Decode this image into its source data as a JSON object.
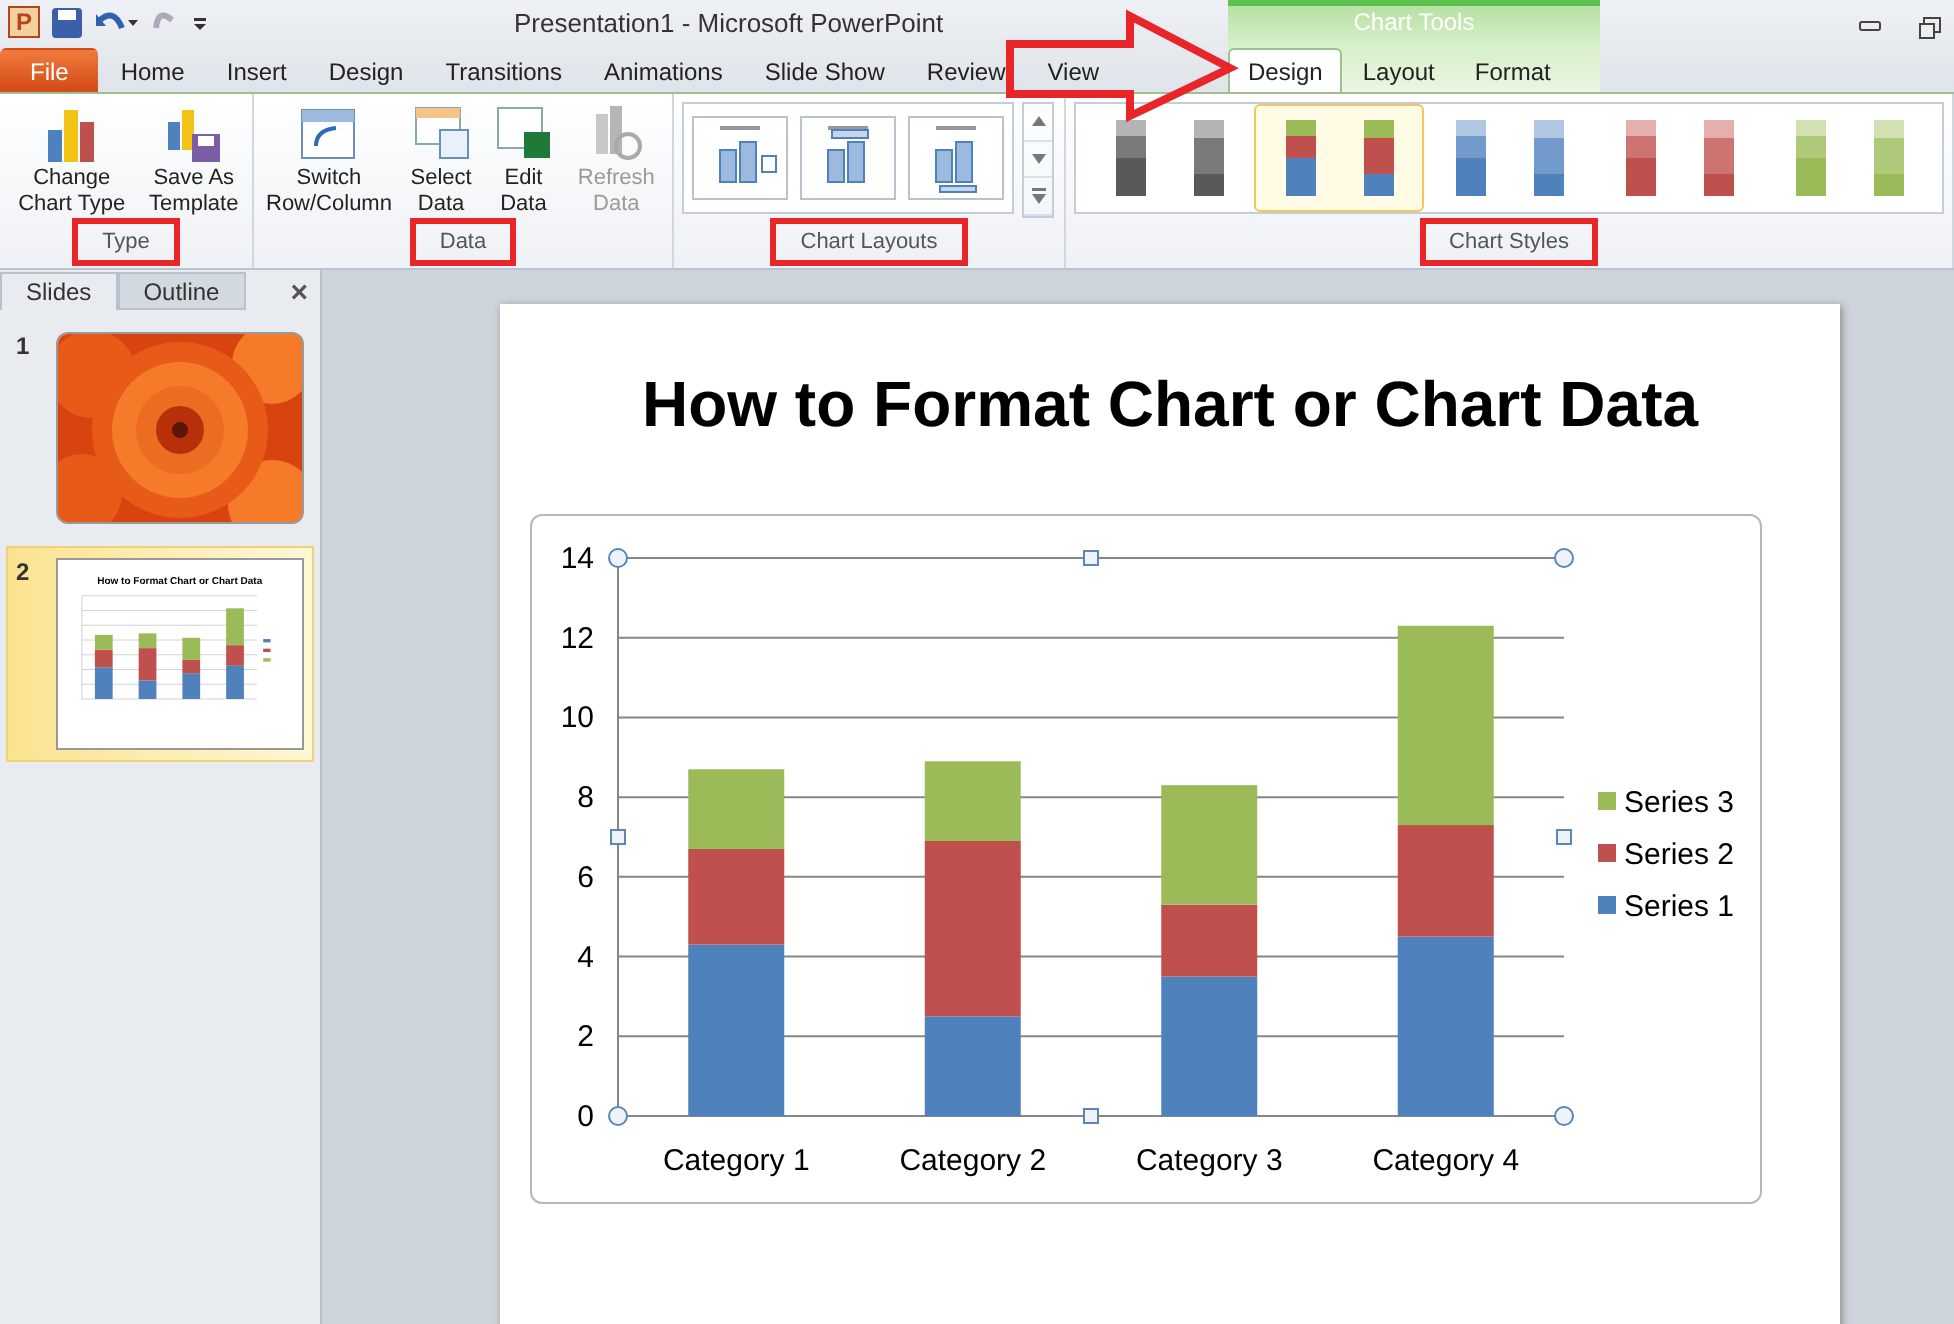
{
  "window": {
    "app_icon_letter": "P",
    "title": "Presentation1  -  Microsoft PowerPoint"
  },
  "tabs": [
    {
      "label": "File",
      "kind": "file",
      "selected": false
    },
    {
      "label": "Home",
      "kind": "tab",
      "selected": false
    },
    {
      "label": "Insert",
      "kind": "tab",
      "selected": false
    },
    {
      "label": "Design",
      "kind": "tab",
      "selected": false
    },
    {
      "label": "Transitions",
      "kind": "tab",
      "selected": false
    },
    {
      "label": "Animations",
      "kind": "tab",
      "selected": false
    },
    {
      "label": "Slide Show",
      "kind": "tab",
      "selected": false
    },
    {
      "label": "Review",
      "kind": "tab",
      "selected": false
    },
    {
      "label": "View",
      "kind": "tab",
      "selected": false
    }
  ],
  "context_tabs": {
    "title": "Chart Tools",
    "tabs": [
      {
        "label": "Design",
        "selected": true
      },
      {
        "label": "Layout",
        "selected": false
      },
      {
        "label": "Format",
        "selected": false
      }
    ]
  },
  "ribbon": {
    "groups": [
      {
        "label": "Type",
        "highlighted": true,
        "buttons": [
          {
            "label": "Change Chart Type",
            "kind": "change-type",
            "disabled": false
          },
          {
            "label": "Save As Template",
            "kind": "template",
            "disabled": false
          }
        ]
      },
      {
        "label": "Data",
        "highlighted": true,
        "buttons": [
          {
            "label": "Switch Row/Column",
            "kind": "switch",
            "disabled": false
          },
          {
            "label": "Select Data",
            "kind": "select",
            "disabled": false
          },
          {
            "label": "Edit Data",
            "kind": "edit",
            "disabled": false
          },
          {
            "label": "Refresh Data",
            "kind": "refresh",
            "disabled": true
          }
        ]
      },
      {
        "label": "Chart Layouts",
        "highlighted": true,
        "layouts": [
          {
            "kind": "legend-right"
          },
          {
            "kind": "table-top"
          },
          {
            "kind": "legend-bottom"
          }
        ]
      },
      {
        "label": "Chart Styles",
        "highlighted": true,
        "styles": [
          {
            "kind": "mono",
            "color": "#595959",
            "selected": false
          },
          {
            "kind": "multi",
            "color": "#4f81bd",
            "selected": true
          },
          {
            "kind": "mono",
            "color": "#4f81bd",
            "selected": false
          },
          {
            "kind": "mono",
            "color": "#c0504d",
            "selected": false
          },
          {
            "kind": "mono",
            "color": "#9bbb59",
            "selected": false
          }
        ]
      }
    ]
  },
  "panel": {
    "tabs": [
      {
        "label": "Slides",
        "selected": true
      },
      {
        "label": "Outline",
        "selected": false
      }
    ],
    "close": "×",
    "slides": [
      {
        "number": "1",
        "kind": "picture",
        "selected": false
      },
      {
        "number": "2",
        "kind": "chart",
        "title": "How to Format  Chart or Chart Data",
        "selected": true
      }
    ]
  },
  "slide": {
    "title": "How to Format Chart or Chart Data",
    "chart_data": {
      "type": "bar",
      "stacked": true,
      "orientation": "vertical",
      "categories": [
        "Category 1",
        "Category 2",
        "Category 3",
        "Category 4"
      ],
      "series": [
        {
          "name": "Series 1",
          "color": "#4f81bd",
          "values": [
            4.3,
            2.5,
            3.5,
            4.5
          ]
        },
        {
          "name": "Series 2",
          "color": "#c0504d",
          "values": [
            2.4,
            4.4,
            1.8,
            2.8
          ]
        },
        {
          "name": "Series 3",
          "color": "#9bbb59",
          "values": [
            2,
            2,
            3,
            5
          ]
        }
      ],
      "grid": true,
      "legend": true,
      "ylim": [
        0,
        14
      ],
      "yticks": [
        0,
        2,
        4,
        6,
        8,
        10,
        12,
        14
      ]
    }
  }
}
